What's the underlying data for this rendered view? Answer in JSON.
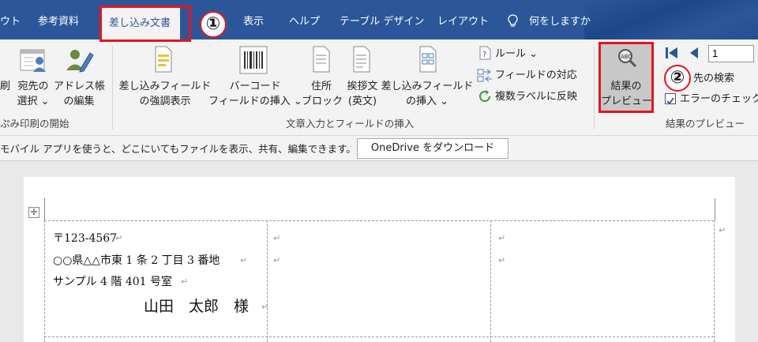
{
  "tabs": [
    {
      "label": "ウト"
    },
    {
      "label": "参考資料"
    },
    {
      "label": "差し込み文書"
    },
    {
      "label": "表示"
    },
    {
      "label": "ヘルプ"
    },
    {
      "label": "テーブル デザイン"
    },
    {
      "label": "レイアウト"
    }
  ],
  "tell_me": "何をしますか",
  "callouts": {
    "one": "①",
    "two": "②"
  },
  "ribbon": {
    "start_group": {
      "print_label": "刷",
      "recipients_label_1": "宛先の",
      "recipients_label_2": "選択 ⌄",
      "addressbook_label_1": "アドレス帳",
      "addressbook_label_2": "の編集",
      "group_label": "ぷみ印刷の開始"
    },
    "write_group": {
      "highlight_label_1": "差し込みフィールド",
      "highlight_label_2": "の強調表示",
      "barcode_label_1": "バーコード",
      "barcode_label_2": "フィールドの挿入 ⌄",
      "address_label_1": "住所",
      "address_label_2": "ブロック",
      "greeting_label_1": "挨拶文",
      "greeting_label_2": "(英文)",
      "insert_field_label_1": "差し込みフィールド",
      "insert_field_label_2": "の挿入 ⌄",
      "rules_label": "ルール ⌄",
      "match_fields_label": "フィールドの対応",
      "update_labels_label": "複数ラベルに反映",
      "group_label": "文章入力とフィールドの挿入"
    },
    "preview_group": {
      "preview_label_1": "結果の",
      "preview_label_2": "プレビュー",
      "record_value": "1",
      "find_label": "先の検索",
      "error_check_label": "エラーのチェック",
      "group_label": "結果のプレビュー"
    }
  },
  "infobar": {
    "message": "モバイル アプリを使うと、どこにいてもファイルを表示、共有、編集できます。",
    "button_label": "OneDrive をダウンロード"
  },
  "document": {
    "postal": "〒123-4567",
    "address1": "○○県△△市東 1 条 2 丁目 3 番地",
    "address2": "サンプル 4 階 401 号室",
    "name": "山田　太郎　様",
    "return_mark": "↵",
    "move_handle": "✛"
  },
  "colors": {
    "tab_bar": "#2b579a",
    "ribbon": "#f3f3f3",
    "highlight_red": "#e8141b",
    "accent_blue": "#2b579a"
  }
}
